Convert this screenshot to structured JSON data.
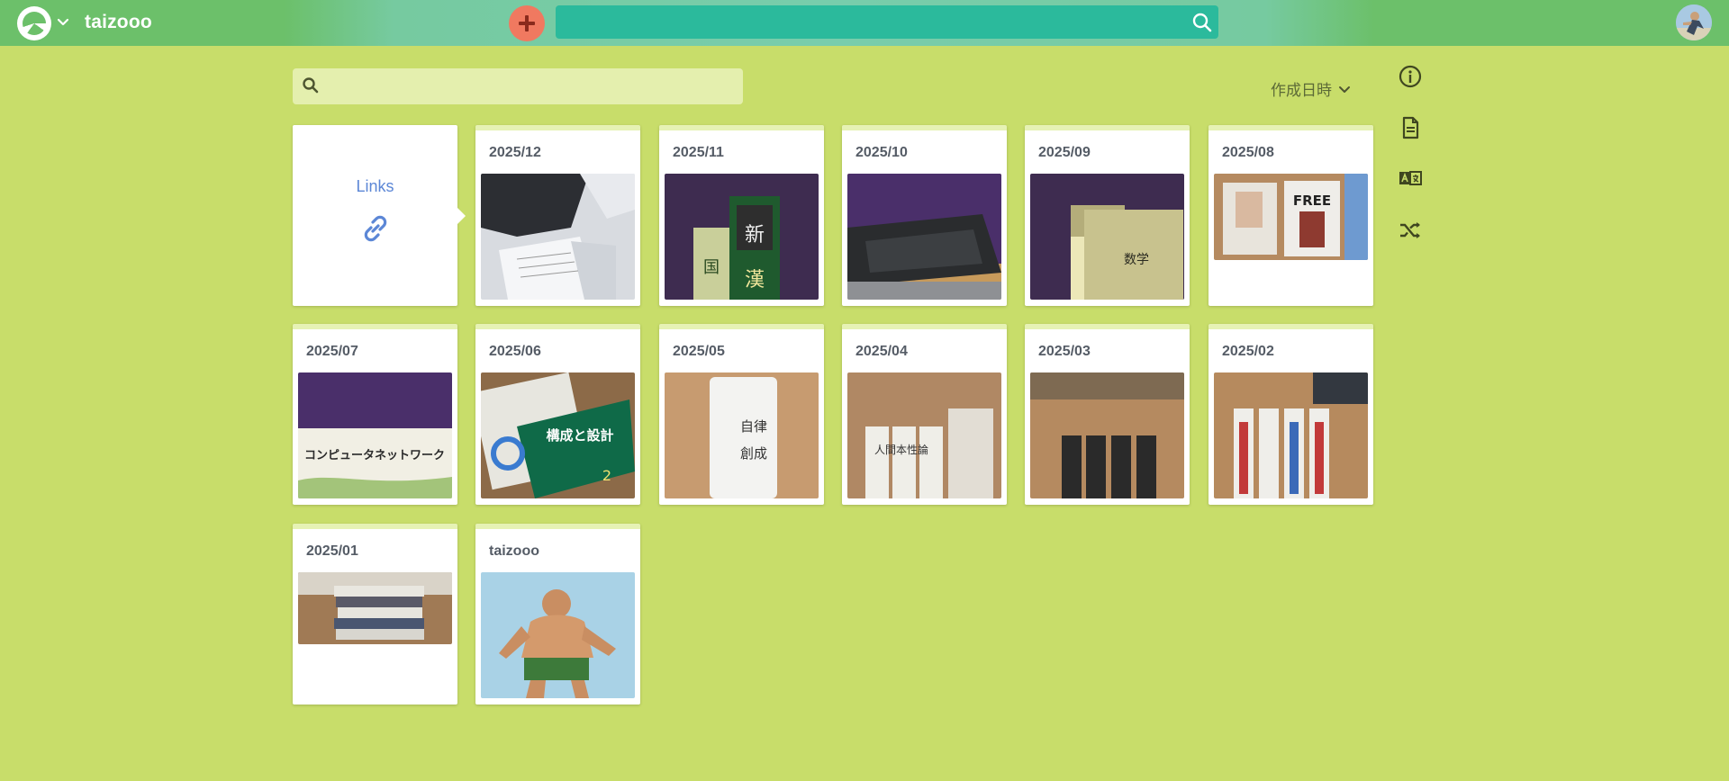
{
  "header": {
    "project_name": "taizooo",
    "colors": {
      "bar": "#6cc06a",
      "search": "#2bba9c",
      "new_button": "#f07960"
    },
    "icons": {
      "logo": "logo-icon",
      "menu": "chevron-down-icon",
      "new": "plus-icon",
      "search": "search-icon",
      "user": "avatar"
    }
  },
  "filter": {
    "placeholder": ""
  },
  "sort": {
    "label": "作成日時"
  },
  "sidebar": {
    "icons": [
      "info-icon",
      "document-icon",
      "translate-icon",
      "shuffle-icon"
    ]
  },
  "links_card": {
    "title": "Links",
    "icon": "link-icon"
  },
  "pages": [
    {
      "title": "2025/12",
      "thumb": "papers-in-car"
    },
    {
      "title": "2025/11",
      "thumb": "dictionaries"
    },
    {
      "title": "2025/10",
      "thumb": "book-dark-cover"
    },
    {
      "title": "2025/09",
      "thumb": "math-book"
    },
    {
      "title": "2025/08",
      "thumb": "free-books"
    },
    {
      "title": "2025/07",
      "thumb": "network-book"
    },
    {
      "title": "2025/06",
      "thumb": "computer-books"
    },
    {
      "title": "2025/05",
      "thumb": "white-book"
    },
    {
      "title": "2025/04",
      "thumb": "shelf-books-a"
    },
    {
      "title": "2025/03",
      "thumb": "shelf-books-b"
    },
    {
      "title": "2025/02",
      "thumb": "rawls-books"
    },
    {
      "title": "2025/01",
      "thumb": "stacked-books"
    },
    {
      "title": "taizooo",
      "thumb": "wrestler"
    }
  ]
}
